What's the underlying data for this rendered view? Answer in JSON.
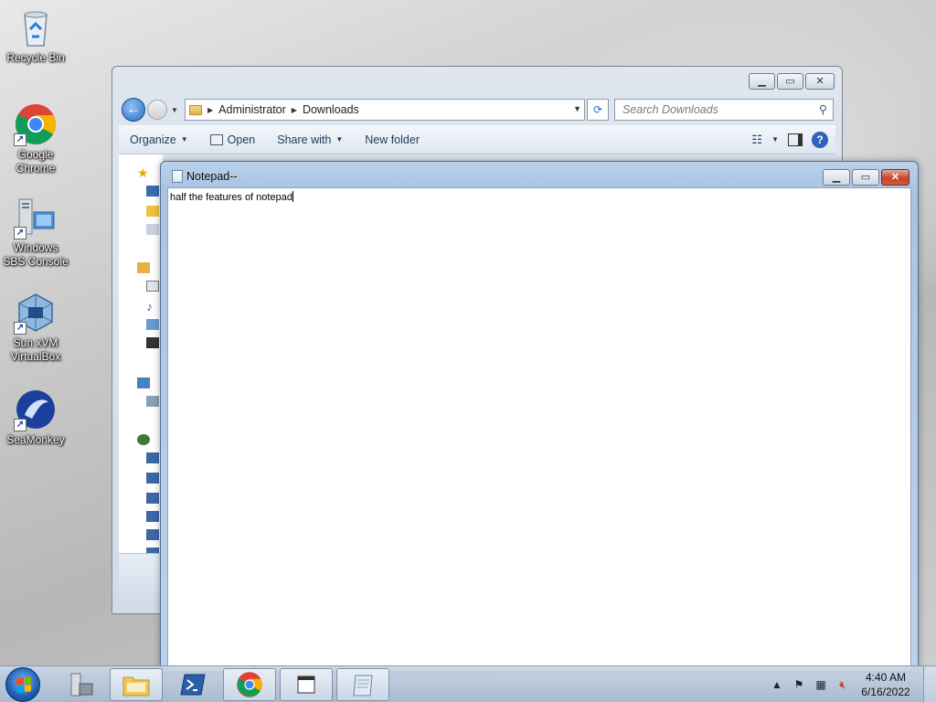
{
  "desktop": {
    "icons": [
      {
        "label": "Recycle Bin",
        "icon": "recycle-bin-icon"
      },
      {
        "label": "Google Chrome",
        "icon": "chrome-icon"
      },
      {
        "label": "Windows SBS Console",
        "icon": "server-console-icon"
      },
      {
        "label": "Sun xVM VirtualBox",
        "icon": "virtualbox-icon"
      },
      {
        "label": "SeaMonkey",
        "icon": "seamonkey-icon"
      }
    ]
  },
  "explorer": {
    "breadcrumb": [
      "Administrator",
      "Downloads"
    ],
    "search_placeholder": "Search Downloads",
    "toolbar": {
      "organize": "Organize",
      "open": "Open",
      "share_with": "Share with",
      "new_folder": "New folder"
    }
  },
  "notepad": {
    "title": "Notepad--",
    "content": "half the features of notepad"
  },
  "taskbar": {
    "time": "4:40 AM",
    "date": "6/16/2022"
  },
  "colors": {
    "accent": "#2a6cc4",
    "close_button": "#c7452c"
  }
}
